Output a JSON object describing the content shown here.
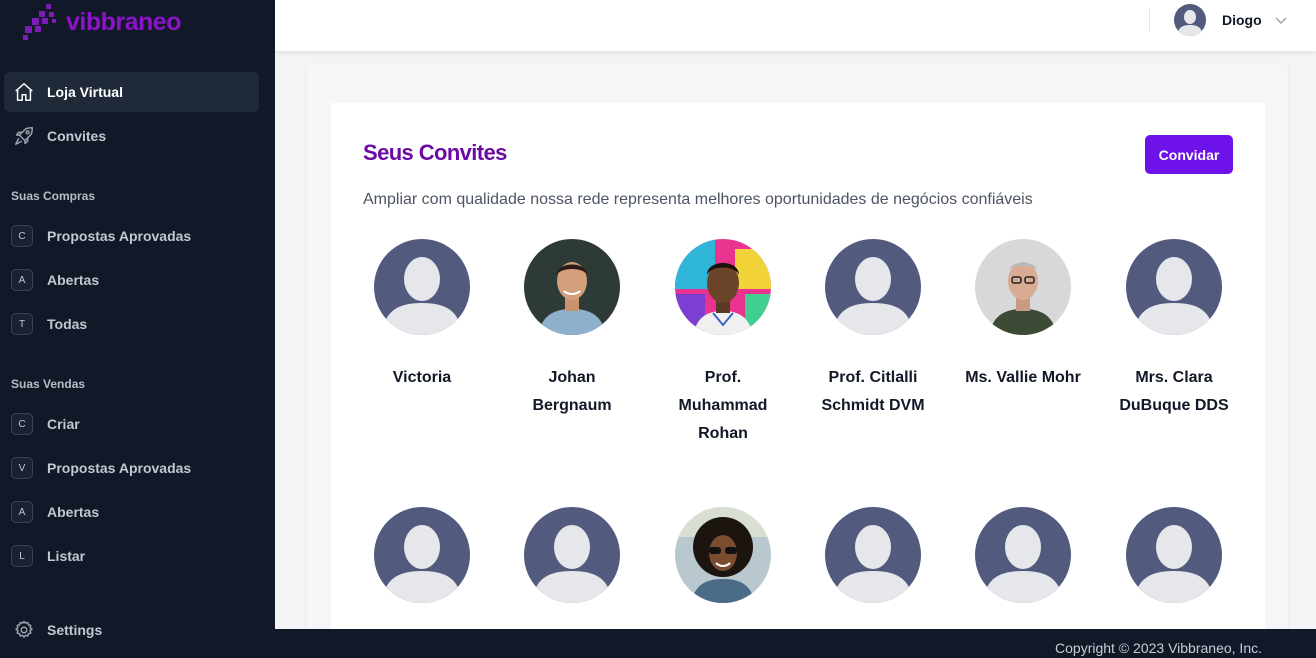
{
  "brand": {
    "name": "vibbraneo",
    "color": "#8b14c9"
  },
  "sidebar": {
    "main_items": [
      {
        "label": "Loja Virtual",
        "icon": "home-icon",
        "active": true
      },
      {
        "label": "Convites",
        "icon": "rocket-icon",
        "active": false
      }
    ],
    "purchases": {
      "title": "Suas Compras",
      "items": [
        {
          "badge": "C",
          "label": "Propostas Aprovadas"
        },
        {
          "badge": "A",
          "label": "Abertas"
        },
        {
          "badge": "T",
          "label": "Todas"
        }
      ]
    },
    "sales": {
      "title": "Suas Vendas",
      "items": [
        {
          "badge": "C",
          "label": "Criar"
        },
        {
          "badge": "V",
          "label": "Propostas Aprovadas"
        },
        {
          "badge": "A",
          "label": "Abertas"
        },
        {
          "badge": "L",
          "label": "Listar"
        }
      ]
    },
    "settings_label": "Settings"
  },
  "header": {
    "user_name": "Diogo"
  },
  "invites": {
    "title": "Seus Convites",
    "subtitle": "Ampliar com qualidade nossa rede representa melhores oportunidades de negócios confiáveis",
    "button_label": "Convidar",
    "people": [
      {
        "name": "Victoria",
        "avatar": "placeholder"
      },
      {
        "name": "Johan Bergnaum",
        "avatar": "photo"
      },
      {
        "name": "Prof. Muhammad Rohan",
        "avatar": "photo"
      },
      {
        "name": "Prof. Citlalli Schmidt DVM",
        "avatar": "placeholder"
      },
      {
        "name": "Ms. Vallie Mohr",
        "avatar": "photo"
      },
      {
        "name": "Mrs. Clara DuBuque DDS",
        "avatar": "placeholder"
      },
      {
        "name": "",
        "avatar": "placeholder"
      },
      {
        "name": "",
        "avatar": "placeholder"
      },
      {
        "name": "",
        "avatar": "photo"
      },
      {
        "name": "",
        "avatar": "placeholder"
      },
      {
        "name": "",
        "avatar": "placeholder"
      },
      {
        "name": "",
        "avatar": "placeholder"
      }
    ]
  },
  "footer": {
    "copyright": "Copyright © 2023 Vibbraneo, Inc."
  },
  "colors": {
    "accent": "#6d12e9",
    "title": "#6b0aa5",
    "sidebar_bg": "#111827",
    "avatar_placeholder": "#525a7e"
  }
}
